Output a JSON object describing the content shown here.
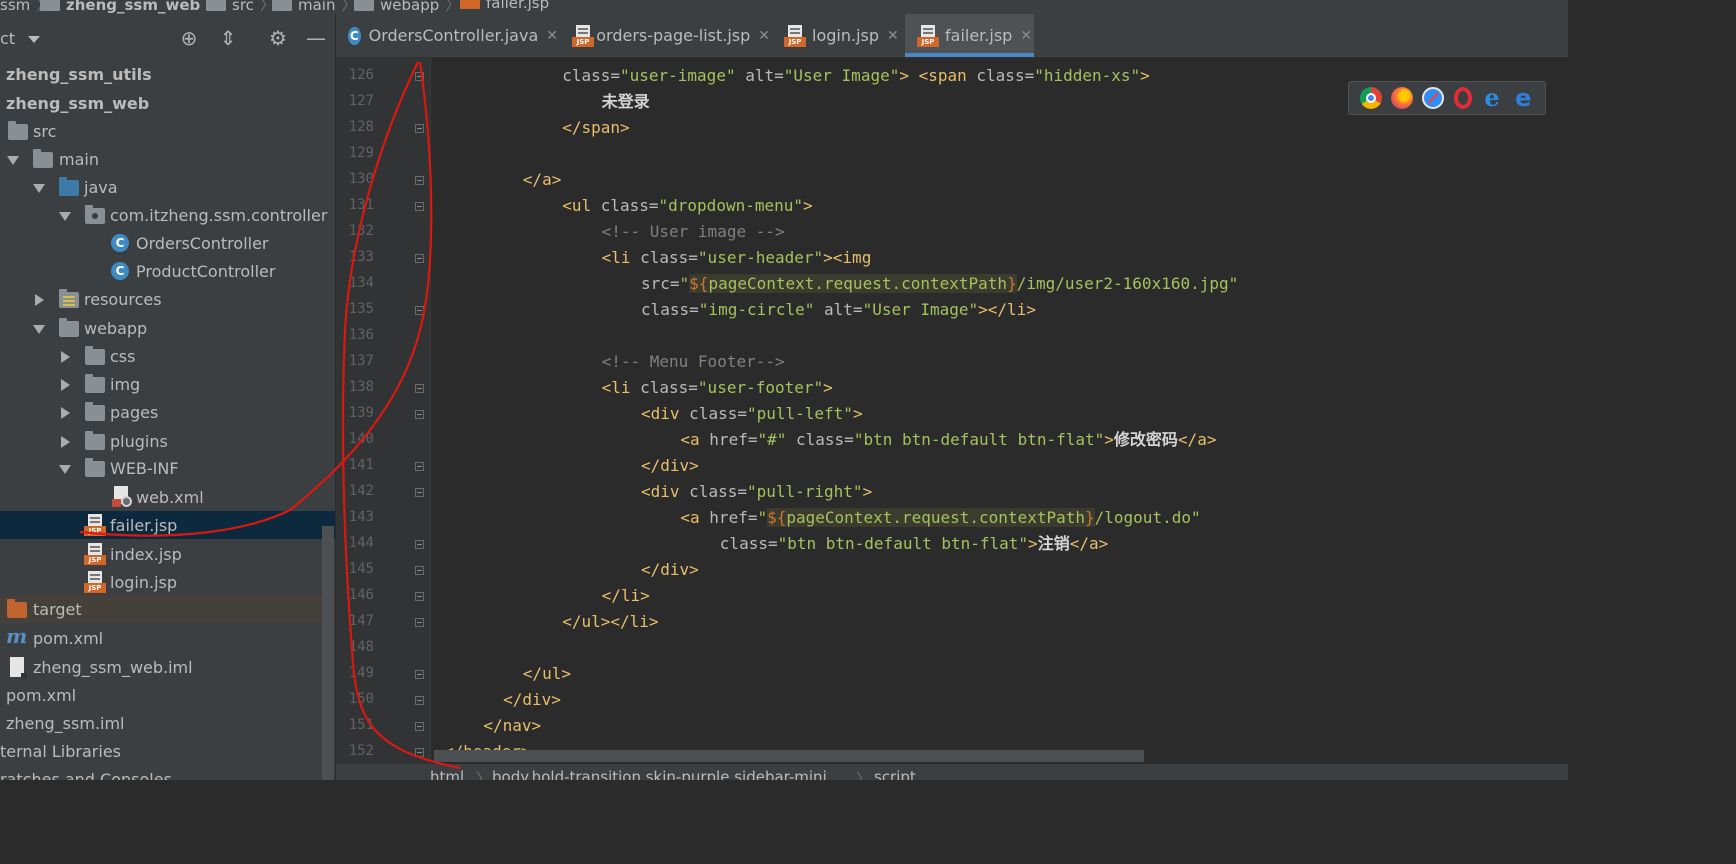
{
  "breadcrumb": {
    "items": [
      "ssm",
      "zheng_ssm_web",
      "src",
      "main",
      "webapp",
      "failer.jsp"
    ]
  },
  "project_panel": {
    "title": "ct",
    "tree": [
      {
        "label": "zheng_ssm_utils",
        "icon": "module-folder"
      },
      {
        "label": "zheng_ssm_web",
        "icon": "module-folder"
      },
      {
        "label": "src",
        "icon": "folder"
      },
      {
        "label": "main",
        "icon": "folder"
      },
      {
        "label": "java",
        "icon": "source-folder"
      },
      {
        "label": "com.itzheng.ssm.controller",
        "icon": "package"
      },
      {
        "label": "OrdersController",
        "icon": "class"
      },
      {
        "label": "ProductController",
        "icon": "class"
      },
      {
        "label": "resources",
        "icon": "resources-folder"
      },
      {
        "label": "webapp",
        "icon": "folder"
      },
      {
        "label": "css",
        "icon": "folder"
      },
      {
        "label": "img",
        "icon": "folder"
      },
      {
        "label": "pages",
        "icon": "folder"
      },
      {
        "label": "plugins",
        "icon": "folder"
      },
      {
        "label": "WEB-INF",
        "icon": "folder"
      },
      {
        "label": "web.xml",
        "icon": "xml-file"
      },
      {
        "label": "failer.jsp",
        "icon": "jsp-file"
      },
      {
        "label": "index.jsp",
        "icon": "jsp-file"
      },
      {
        "label": "login.jsp",
        "icon": "jsp-file"
      },
      {
        "label": "target",
        "icon": "excluded-folder"
      },
      {
        "label": "pom.xml",
        "icon": "maven-file"
      },
      {
        "label": "zheng_ssm_web.iml",
        "icon": "iml-file"
      },
      {
        "label": "pom.xml",
        "icon": "maven-file"
      },
      {
        "label": "zheng_ssm.iml",
        "icon": "iml-file"
      },
      {
        "label": "ternal Libraries",
        "icon": "libraries"
      },
      {
        "label": "ratches and Consoles",
        "icon": "scratches"
      }
    ]
  },
  "tabs": [
    {
      "label": "OrdersController.java",
      "icon": "class",
      "active": false
    },
    {
      "label": "orders-page-list.jsp",
      "icon": "jsp-file",
      "active": false
    },
    {
      "label": "login.jsp",
      "icon": "jsp-file",
      "active": false
    },
    {
      "label": "failer.jsp",
      "icon": "jsp-file",
      "active": true
    }
  ],
  "editor": {
    "line_numbers": [
      "126",
      "127",
      "128",
      "129",
      "130",
      "131",
      "132",
      "133",
      "134",
      "135",
      "136",
      "137",
      "138",
      "139",
      "140",
      "141",
      "142",
      "143",
      "144",
      "145",
      "146",
      "147",
      "148",
      "149",
      "150",
      "151",
      "152"
    ],
    "lines": [
      {
        "indent": 12,
        "tokens": [
          [
            "at",
            "class="
          ],
          [
            "st",
            "\"user-image\""
          ],
          [
            "at",
            " alt="
          ],
          [
            "st",
            "\"User Image\""
          ],
          [
            "tg1",
            "> <span "
          ],
          [
            "at",
            "class="
          ],
          [
            "st",
            "\"hidden-xs\""
          ],
          [
            "tg1",
            ">"
          ]
        ]
      },
      {
        "indent": 16,
        "tokens": [
          [
            "cjk",
            "未登录"
          ]
        ]
      },
      {
        "indent": 12,
        "tokens": [
          [
            "tg1",
            "</span>"
          ]
        ]
      },
      {
        "indent": 0,
        "tokens": []
      },
      {
        "indent": 8,
        "tokens": [
          [
            "tg1",
            "</a>"
          ]
        ]
      },
      {
        "indent": 12,
        "tokens": [
          [
            "tg1",
            "<ul "
          ],
          [
            "at",
            "class="
          ],
          [
            "st",
            "\"dropdown-menu\""
          ],
          [
            "tg1",
            ">"
          ]
        ]
      },
      {
        "indent": 16,
        "tokens": [
          [
            "cm",
            "<!-- User image -->"
          ]
        ]
      },
      {
        "indent": 16,
        "tokens": [
          [
            "tg1",
            "<li "
          ],
          [
            "at",
            "class="
          ],
          [
            "st",
            "\"user-header\""
          ],
          [
            "tg1",
            "><img"
          ]
        ]
      },
      {
        "indent": 20,
        "tokens": [
          [
            "at",
            "src="
          ],
          [
            "st",
            "\""
          ],
          [
            "elb",
            "${"
          ],
          [
            "el",
            "pageContext.request.contextPath"
          ],
          [
            "elb",
            "}"
          ],
          [
            "st",
            "/img/user2-160x160.jpg\""
          ]
        ]
      },
      {
        "indent": 20,
        "tokens": [
          [
            "at",
            "class="
          ],
          [
            "st",
            "\"img-circle\""
          ],
          [
            "at",
            " alt="
          ],
          [
            "st",
            "\"User Image\""
          ],
          [
            "tg1",
            "></li>"
          ]
        ]
      },
      {
        "indent": 0,
        "tokens": []
      },
      {
        "indent": 16,
        "tokens": [
          [
            "cm",
            "<!-- Menu Footer-->"
          ]
        ]
      },
      {
        "indent": 16,
        "tokens": [
          [
            "tg1",
            "<li "
          ],
          [
            "at",
            "class="
          ],
          [
            "st",
            "\"user-footer\""
          ],
          [
            "tg1",
            ">"
          ]
        ]
      },
      {
        "indent": 20,
        "tokens": [
          [
            "tg1",
            "<div "
          ],
          [
            "at",
            "class="
          ],
          [
            "st",
            "\"pull-left\""
          ],
          [
            "tg1",
            ">"
          ]
        ]
      },
      {
        "indent": 24,
        "tokens": [
          [
            "tg1",
            "<a "
          ],
          [
            "at",
            "href="
          ],
          [
            "st",
            "\"#\""
          ],
          [
            "at",
            " class="
          ],
          [
            "st",
            "\"btn btn-default btn-flat\""
          ],
          [
            "tg1",
            ">"
          ],
          [
            "cjk",
            "修改密码"
          ],
          [
            "tg1",
            "</a>"
          ]
        ]
      },
      {
        "indent": 20,
        "tokens": [
          [
            "tg1",
            "</div>"
          ]
        ]
      },
      {
        "indent": 20,
        "tokens": [
          [
            "tg1",
            "<div "
          ],
          [
            "at",
            "class="
          ],
          [
            "st",
            "\"pull-right\""
          ],
          [
            "tg1",
            ">"
          ]
        ]
      },
      {
        "indent": 24,
        "tokens": [
          [
            "tg1",
            "<a "
          ],
          [
            "at",
            "href="
          ],
          [
            "st",
            "\""
          ],
          [
            "elb",
            "${"
          ],
          [
            "el",
            "pageContext.request.contextPath"
          ],
          [
            "elb",
            "}"
          ],
          [
            "st",
            "/logout.do\""
          ]
        ]
      },
      {
        "indent": 28,
        "tokens": [
          [
            "at",
            "class="
          ],
          [
            "st",
            "\"btn btn-default btn-flat\""
          ],
          [
            "tg1",
            ">"
          ],
          [
            "cjk",
            "注销"
          ],
          [
            "tg1",
            "</a>"
          ]
        ]
      },
      {
        "indent": 20,
        "tokens": [
          [
            "tg1",
            "</div>"
          ]
        ]
      },
      {
        "indent": 16,
        "tokens": [
          [
            "tg1",
            "</li>"
          ]
        ]
      },
      {
        "indent": 12,
        "tokens": [
          [
            "tg1",
            "</ul></li>"
          ]
        ]
      },
      {
        "indent": 0,
        "tokens": []
      },
      {
        "indent": 8,
        "tokens": [
          [
            "tg1",
            "</ul>"
          ]
        ]
      },
      {
        "indent": 6,
        "tokens": [
          [
            "tg1",
            "</div>"
          ]
        ]
      },
      {
        "indent": 4,
        "tokens": [
          [
            "tg1",
            "</nav>"
          ]
        ]
      },
      {
        "indent": 0,
        "tokens": [
          [
            "tg1",
            "</header>"
          ]
        ]
      }
    ]
  },
  "status_breadcrumb": [
    "html",
    "body.hold-transition.skin-purple.sidebar-mini",
    "script"
  ],
  "browser_icons": [
    "chrome-icon",
    "firefox-icon",
    "safari-icon",
    "opera-icon",
    "ie-icon",
    "edge-icon"
  ],
  "colors": {
    "background": "#2b2b2b",
    "panel": "#3c3f41",
    "tag": "#e8bf6a",
    "string": "#a5c25c",
    "comment": "#808080",
    "annotation": "#d9190f"
  }
}
